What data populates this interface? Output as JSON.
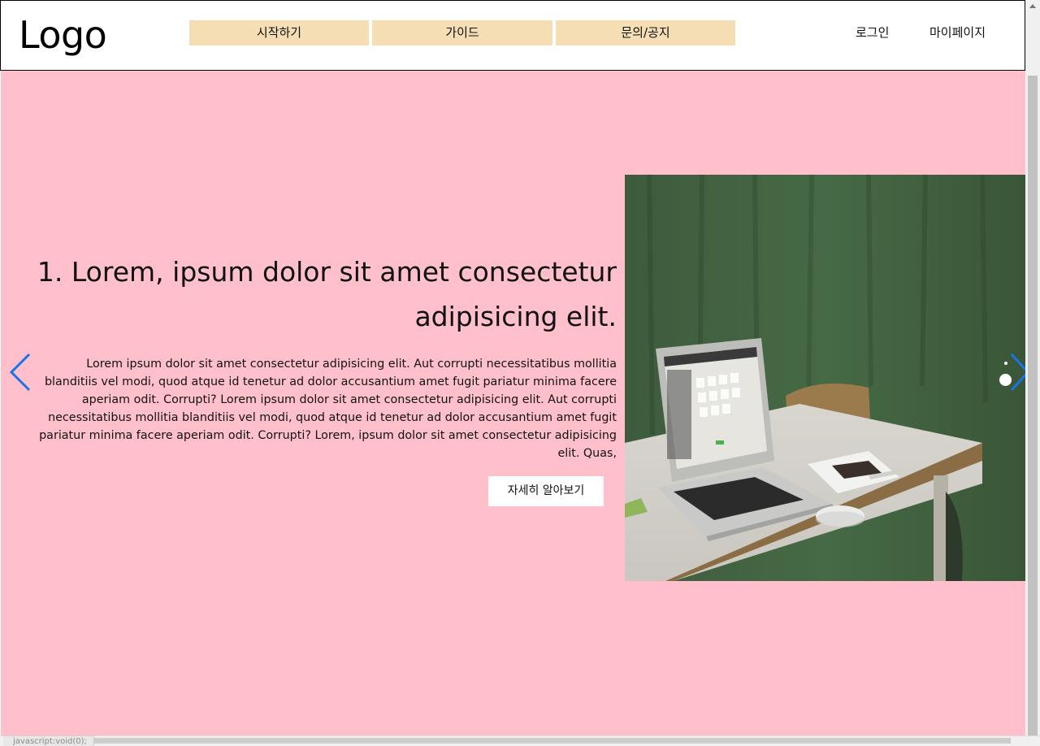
{
  "header": {
    "logo": "Logo",
    "nav": [
      {
        "label": "시작하기"
      },
      {
        "label": "가이드"
      },
      {
        "label": "문의/공지"
      }
    ],
    "user_links": {
      "login": "로그인",
      "mypage": "마이페이지"
    }
  },
  "hero": {
    "title": "1. Lorem, ipsum dolor sit amet consectetur adipisicing elit.",
    "body": "Lorem ipsum dolor sit amet consectetur adipisicing elit. Aut corrupti necessitatibus mollitia blanditiis vel modi, quod atque id tenetur ad dolor accusantium amet fugit pariatur minima facere aperiam odit. Corrupti? Lorem ipsum dolor sit amet consectetur adipisicing elit. Aut corrupti necessitatibus mollitia blanditiis vel modi, quod atque id tenetur ad dolor accusantium amet fugit pariatur minima facere aperiam odit. Corrupti? Lorem, ipsum dolor sit amet consectetur adipisicing elit. Quas,",
    "cta_label": "자세히 알아보기",
    "prev_icon": "chevron-left-icon",
    "next_icon": "chevron-right-icon",
    "pagination": {
      "count": 2,
      "active": 2
    }
  },
  "colors": {
    "hero_bg": "#ffc0cb",
    "nav_bg": "#f5deb3",
    "arrow": "#1a73e8"
  },
  "status_bar": {
    "url": "javascript:void(0);"
  }
}
